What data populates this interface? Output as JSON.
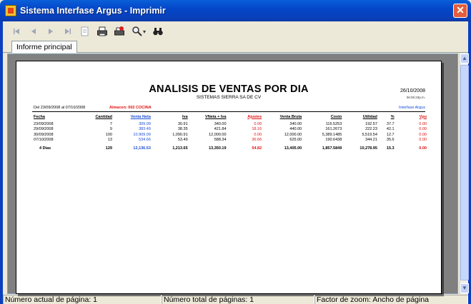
{
  "window": {
    "title": "Sistema Interfase Argus - Imprimir",
    "close_label": "✕"
  },
  "toolbar": {
    "buttons": [
      "first-page",
      "prev-page",
      "next-page",
      "last-page",
      "export",
      "print",
      "print-setup",
      "zoom",
      "search"
    ],
    "zoom_caret": "▾"
  },
  "tabs": [
    {
      "label": "Informe principal"
    }
  ],
  "report": {
    "title": "ANALISIS DE VENTAS POR DIA",
    "subtitle": "SISTEMAS SIERRA SA DE CV",
    "date": "26/10/2008",
    "time": "06:05:23p.m.",
    "range": "Del 23/09/2008 al 07/10/2008",
    "almacen": "Almacen: 002 COCINA",
    "brand": "Interfase Argus",
    "columns": [
      "Fecha",
      "Cantidad",
      "Venta Neta",
      "Iva",
      "VNeta + Iva",
      "Ajustes",
      "Venta Bruta",
      "Costo",
      "Utilidad",
      "%",
      "Vpu"
    ],
    "rows": [
      [
        "23/09/2008",
        "7",
        "309.09",
        "30.91",
        "340.00",
        "0.00",
        "340.00",
        "116.5253",
        "192.57",
        "37.7",
        "0.00"
      ],
      [
        "29/09/2008",
        "9",
        "383.49",
        "38.35",
        "421.84",
        "18.16",
        "440.00",
        "161.2673",
        "222.23",
        "42.1",
        "0.00"
      ],
      [
        "30/09/2008",
        "100",
        "10.909.09",
        "1,090.91",
        "12,000.00",
        "0.00",
        "12,000.00",
        "5,389.1485",
        "5,519.54",
        "12.7",
        "0.00"
      ],
      [
        "07/10/2008",
        "13",
        "534.66",
        "53.49",
        "588.34",
        "36.66",
        "625.00",
        "190.6438",
        "344.21",
        "35.6",
        "0.00"
      ]
    ],
    "total": [
      "4  Dias",
      "129",
      "12,136.53",
      "1,213.65",
      "13,350.19",
      "54.82",
      "13,405.00",
      "1,857.5849",
      "10,278.95",
      "15.3",
      "0.00"
    ]
  },
  "status": {
    "current_page": "Número actual de página: 1",
    "total_pages": "Número total de páginas: 1",
    "zoom": "Factor de zoom: Ancho de página"
  }
}
